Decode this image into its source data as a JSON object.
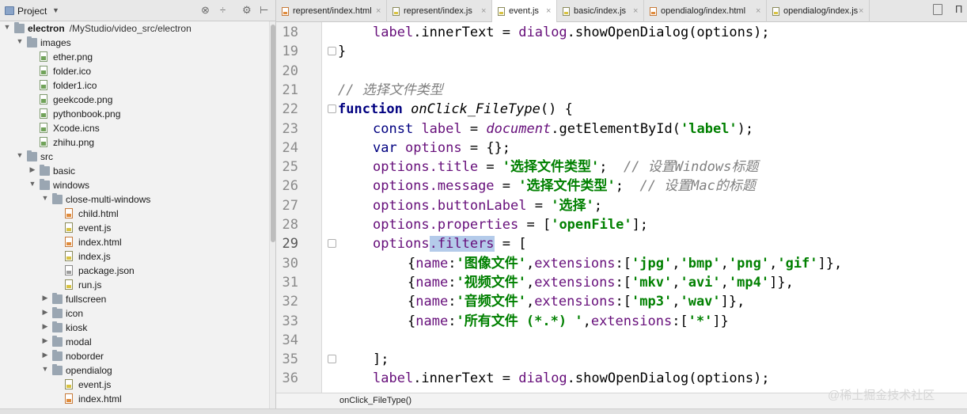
{
  "project_panel": {
    "title": "Project",
    "tools": [
      "target-icon",
      "collapse-icon",
      "gear-icon",
      "hide-icon"
    ],
    "tree": [
      {
        "name": "electron",
        "path": "/MyStudio/video_src/electron",
        "type": "root",
        "expanded": true
      },
      {
        "name": "images",
        "type": "folder",
        "expanded": true
      },
      {
        "name": "ether.png",
        "type": "image"
      },
      {
        "name": "folder.ico",
        "type": "image"
      },
      {
        "name": "folder1.ico",
        "type": "image"
      },
      {
        "name": "geekcode.png",
        "type": "image"
      },
      {
        "name": "pythonbook.png",
        "type": "image"
      },
      {
        "name": "Xcode.icns",
        "type": "image"
      },
      {
        "name": "zhihu.png",
        "type": "image"
      },
      {
        "name": "src",
        "type": "folder",
        "expanded": true
      },
      {
        "name": "basic",
        "type": "folder",
        "expanded": false
      },
      {
        "name": "windows",
        "type": "folder",
        "expanded": true
      },
      {
        "name": "close-multi-windows",
        "type": "folder",
        "expanded": true
      },
      {
        "name": "child.html",
        "type": "html"
      },
      {
        "name": "event.js",
        "type": "js"
      },
      {
        "name": "index.html",
        "type": "html"
      },
      {
        "name": "index.js",
        "type": "js"
      },
      {
        "name": "package.json",
        "type": "json"
      },
      {
        "name": "run.js",
        "type": "js"
      },
      {
        "name": "fullscreen",
        "type": "folder",
        "expanded": false
      },
      {
        "name": "icon",
        "type": "folder",
        "expanded": false
      },
      {
        "name": "kiosk",
        "type": "folder",
        "expanded": false
      },
      {
        "name": "modal",
        "type": "folder",
        "expanded": false
      },
      {
        "name": "noborder",
        "type": "folder",
        "expanded": false
      },
      {
        "name": "opendialog",
        "type": "folder",
        "expanded": true
      },
      {
        "name": "event.js",
        "type": "js"
      },
      {
        "name": "index.html",
        "type": "html"
      }
    ]
  },
  "tabs": [
    {
      "label": "represent/index.html",
      "type": "html",
      "active": false
    },
    {
      "label": "represent/index.js",
      "type": "js",
      "active": false
    },
    {
      "label": "event.js",
      "type": "js",
      "active": true
    },
    {
      "label": "basic/index.js",
      "type": "js",
      "active": false
    },
    {
      "label": "opendialog/index.html",
      "type": "html",
      "active": false
    },
    {
      "label": "opendialog/index.js",
      "type": "js",
      "active": false
    }
  ],
  "tab_overflow_label": "П",
  "editor": {
    "current_line": 29,
    "lines": [
      {
        "no": "18",
        "fold": false
      },
      {
        "no": "19",
        "fold": true
      },
      {
        "no": "20",
        "fold": false
      },
      {
        "no": "21",
        "fold": false
      },
      {
        "no": "22",
        "fold": true
      },
      {
        "no": "23",
        "fold": false
      },
      {
        "no": "24",
        "fold": false
      },
      {
        "no": "25",
        "fold": false
      },
      {
        "no": "26",
        "fold": false
      },
      {
        "no": "27",
        "fold": false
      },
      {
        "no": "28",
        "fold": false
      },
      {
        "no": "29",
        "fold": true
      },
      {
        "no": "30",
        "fold": false
      },
      {
        "no": "31",
        "fold": false
      },
      {
        "no": "32",
        "fold": false
      },
      {
        "no": "33",
        "fold": false
      },
      {
        "no": "34",
        "fold": false
      },
      {
        "no": "35",
        "fold": true
      },
      {
        "no": "36",
        "fold": false
      }
    ],
    "code": {
      "l18": {
        "a": "label",
        "b": ".innerText = ",
        "c": "dialog",
        "d": ".showOpenDialog(options);"
      },
      "l19": "}",
      "l21": "// 选择文件类型",
      "l22": {
        "kw": "function",
        "fn": "onClick_FileType",
        "rest": "() {"
      },
      "l23": {
        "kw": "const",
        "var": "label",
        "eq": " = ",
        "glb": "document",
        "m": ".getElementById(",
        "s": "'label'",
        "end": ");"
      },
      "l24": {
        "kw": "var",
        "var": "options",
        "rest": " = {};"
      },
      "l25": {
        "obj": "options",
        "prop": ".title",
        "eq": " = ",
        "s": "'选择文件类型'",
        "semi": ";",
        "cmt": "  // 设置Windows标题"
      },
      "l26": {
        "obj": "options",
        "prop": ".message",
        "eq": " = ",
        "s": "'选择文件类型'",
        "semi": ";",
        "cmt": "  // 设置Mac的标题"
      },
      "l27": {
        "obj": "options",
        "prop": ".buttonLabel",
        "eq": " = ",
        "s": "'选择'",
        "semi": ";"
      },
      "l28": {
        "obj": "options",
        "prop": ".properties",
        "eq": " = [",
        "s": "'openFile'",
        "end": "];"
      },
      "l29": {
        "obj": "options",
        "sel": ".filters",
        "eq": " = ["
      },
      "l30": {
        "o": "{",
        "k1": "name",
        "c1": ":",
        "s1": "'图像文件'",
        "c2": ",",
        "k2": "extensions",
        "c3": ":[",
        "s2": "'jpg'",
        "c4": ",",
        "s3": "'bmp'",
        "c5": ",",
        "s4": "'png'",
        "c6": ",",
        "s5": "'gif'",
        "end": "]},"
      },
      "l31": {
        "o": "{",
        "k1": "name",
        "c1": ":",
        "s1": "'视频文件'",
        "c2": ",",
        "k2": "extensions",
        "c3": ":[",
        "s2": "'mkv'",
        "c4": ",",
        "s3": "'avi'",
        "c5": ",",
        "s4": "'mp4'",
        "end": "]},"
      },
      "l32": {
        "o": "{",
        "k1": "name",
        "c1": ":",
        "s1": "'音频文件'",
        "c2": ",",
        "k2": "extensions",
        "c3": ":[",
        "s2": "'mp3'",
        "c4": ",",
        "s3": "'wav'",
        "end": "]},"
      },
      "l33": {
        "o": "{",
        "k1": "name",
        "c1": ":",
        "s1": "'所有文件 (*.*) '",
        "c2": ",",
        "k2": "extensions",
        "c3": ":[",
        "s2": "'*'",
        "end": "]}"
      },
      "l35": "];",
      "l36": {
        "a": "label",
        "b": ".innerText = ",
        "c": "dialog",
        "d": ".showOpenDialog(options);"
      }
    }
  },
  "breadcrumb": "onClick_FileType()",
  "watermark": "@稀土掘金技术社区",
  "colors": {
    "keyword": "#000080",
    "string": "#008000",
    "comment": "#808080",
    "property": "#660e7a",
    "selection": "#b4cbea",
    "current_line": "#fcfbe6"
  }
}
